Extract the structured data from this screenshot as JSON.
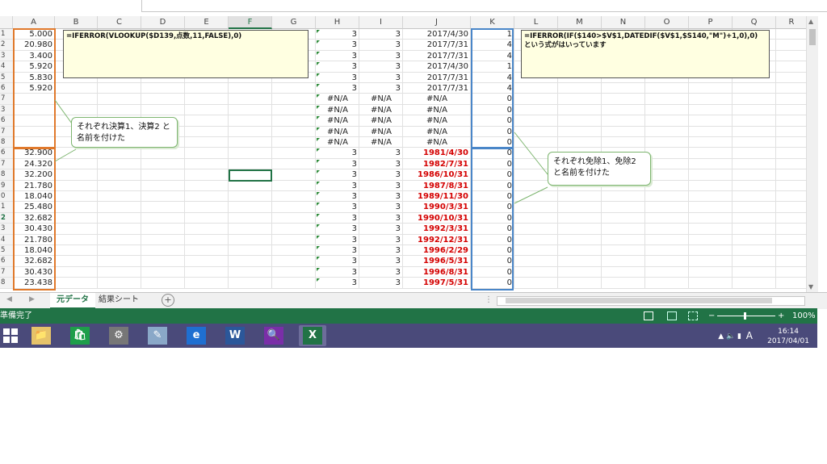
{
  "columns": [
    "A",
    "B",
    "C",
    "D",
    "E",
    "F",
    "G",
    "H",
    "I",
    "J",
    "K",
    "L",
    "M",
    "N",
    "O",
    "P",
    "Q",
    "R"
  ],
  "selected_column": "F",
  "row_numbers": [
    "1",
    "2",
    "3",
    "4",
    "5",
    "6",
    "7",
    "3",
    "6",
    "7",
    "8",
    "6",
    "7",
    "8",
    "9",
    "0",
    "1",
    "2",
    "3",
    "4",
    "5",
    "6",
    "7",
    "8"
  ],
  "selected_row_index": 17,
  "col_a_values": [
    "5.000",
    "20.980",
    "3.400",
    "5.920",
    "5.830",
    "5.920",
    "",
    "",
    "",
    "",
    "",
    "32.900",
    "24.320",
    "32.200",
    "21.780",
    "18.040",
    "25.480",
    "32.682",
    "30.430",
    "21.780",
    "18.040",
    "32.682",
    "30.430",
    "23.438"
  ],
  "col_h_values": [
    "3",
    "3",
    "3",
    "3",
    "3",
    "3",
    "#N/A",
    "#N/A",
    "#N/A",
    "#N/A",
    "#N/A",
    "3",
    "3",
    "3",
    "3",
    "3",
    "3",
    "3",
    "3",
    "3",
    "3",
    "3",
    "3",
    "3"
  ],
  "col_i_values": [
    "3",
    "3",
    "3",
    "3",
    "3",
    "3",
    "#N/A",
    "#N/A",
    "#N/A",
    "#N/A",
    "#N/A",
    "3",
    "3",
    "3",
    "3",
    "3",
    "3",
    "3",
    "3",
    "3",
    "3",
    "3",
    "3",
    "3"
  ],
  "col_j_values": [
    "2017/4/30",
    "2017/7/31",
    "2017/7/31",
    "2017/4/30",
    "2017/7/31",
    "2017/7/31",
    "#N/A",
    "#N/A",
    "#N/A",
    "#N/A",
    "#N/A",
    "1981/4/30",
    "1982/7/31",
    "1986/10/31",
    "1987/8/31",
    "1989/11/30",
    "1990/3/31",
    "1990/10/31",
    "1992/3/31",
    "1992/12/31",
    "1996/2/29",
    "1996/5/31",
    "1996/8/31",
    "1997/5/31"
  ],
  "col_k_values": [
    "1",
    "4",
    "4",
    "1",
    "4",
    "4",
    "0",
    "0",
    "0",
    "0",
    "0",
    "0",
    "0",
    "0",
    "0",
    "0",
    "0",
    "0",
    "0",
    "0",
    "0",
    "0",
    "0",
    "0"
  ],
  "comment_left": "=IFERROR(VLOOKUP($D139,点数,11,FALSE),0)",
  "comment_right": "=IFERROR(IF($140>$V$1,DATEDIF($V$1,$S140,\"M\")+1,0),0)\nという式がはいっています",
  "callout_left": "それぞれ決算1、決算2\nと名前を付けた",
  "callout_right": "それぞれ免除1、免除2\nと名前を付けた",
  "sheet_tabs": [
    "元データ",
    "結果シート"
  ],
  "active_tab": 0,
  "status_text": "準備完了",
  "zoom_text": "100%",
  "clock_time": "16:14",
  "clock_date": "2017/04/01",
  "ime_indicator": "A",
  "taskbar_apps": [
    "explorer-icon",
    "store-icon",
    "network-icon",
    "notepad-icon",
    "ie-icon",
    "word-icon",
    "search-app-icon",
    "excel-icon"
  ],
  "colors": {
    "accent": "#217346",
    "taskbar": "#4a4a7a",
    "orange_box": "#e0792b",
    "blue_box": "#4a86c8",
    "red_text": "#d40000"
  }
}
